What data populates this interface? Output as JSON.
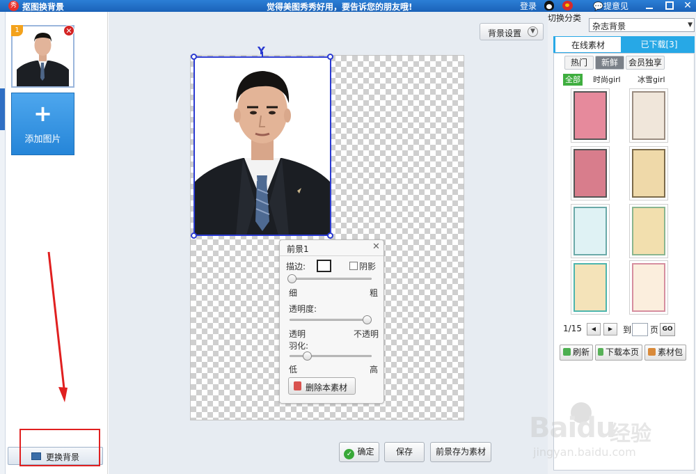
{
  "titlebar": {
    "app_title": "抠图换背景",
    "slogan": "觉得美图秀秀好用，要告诉您的朋友哦!",
    "login": "登录",
    "feedback": "提意见",
    "close": "✕"
  },
  "left": {
    "thumb_badge": "1",
    "add_label": "添加图片",
    "change_bg_label": "更换背景"
  },
  "canvas": {
    "bg_settings_label": "背景设置",
    "fg_panel": {
      "title": "前景1",
      "stroke_label": "描边:",
      "shadow_label": "阴影",
      "thin": "细",
      "thick": "粗",
      "opacity_label": "透明度:",
      "transparent": "透明",
      "opaque": "不透明",
      "feather_label": "羽化:",
      "low": "低",
      "high": "高",
      "delete_label": "删除本素材"
    },
    "ok_label": "确定",
    "save_label": "保存",
    "save_fg_label": "前景存为素材"
  },
  "right": {
    "switch_label": "切换分类",
    "category": "杂志背景",
    "tabs": {
      "online": "在线素材",
      "downloaded": "已下载[3]"
    },
    "subtabs": [
      "热门",
      "新鲜",
      "会员独享"
    ],
    "filters": [
      "全部",
      "时尚girl",
      "冰雪girl"
    ],
    "page_indicator": "1/15",
    "goto_label": "到",
    "page_label": "页",
    "go": "GO",
    "refresh": "刷新",
    "download_page": "下载本页",
    "material_pack": "素材包"
  },
  "watermark": {
    "brand": "Bai",
    "brand2": "du",
    "cn": "经验",
    "url": "jingyan.baidu.com"
  },
  "colors": {
    "titlebar": "#1a62b8",
    "selection": "#2b3bd1",
    "tab_accent": "#27a8e6",
    "filter_accent": "#3fae3f",
    "highlight_red": "#e02020"
  }
}
